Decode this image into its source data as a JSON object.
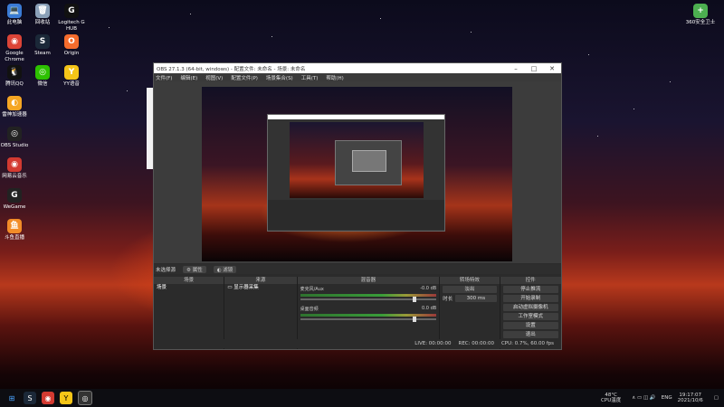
{
  "desktop": {
    "icons_left": [
      {
        "label": "此电脑",
        "color": "#3a7bd5",
        "glyph": "💻"
      },
      {
        "label": "Google Chrome",
        "color": "#db4437",
        "glyph": "◉"
      },
      {
        "label": "腾讯QQ",
        "color": "#111111",
        "glyph": "🐧"
      },
      {
        "label": "雷神加速器",
        "color": "#f5a623",
        "glyph": "◐"
      },
      {
        "label": "OBS Studio",
        "color": "#222222",
        "glyph": "◎"
      },
      {
        "label": "网易云音乐",
        "color": "#d33a31",
        "glyph": "◉"
      },
      {
        "label": "WeGame",
        "color": "#222222",
        "glyph": "G"
      },
      {
        "label": "斗鱼直播",
        "color": "#f28c28",
        "glyph": "鱼"
      }
    ],
    "icons_col2": [
      {
        "label": "回收站",
        "color": "#8aa0b8",
        "glyph": "🗑"
      },
      {
        "label": "Steam",
        "color": "#1b2838",
        "glyph": "S"
      },
      {
        "label": "微信",
        "color": "#2dc100",
        "glyph": "◎"
      }
    ],
    "icons_col3": [
      {
        "label": "Logitech G HUB",
        "color": "#111111",
        "glyph": "G"
      },
      {
        "label": "Origin",
        "color": "#f56c2d",
        "glyph": "O"
      },
      {
        "label": "YY语音",
        "color": "#f5c518",
        "glyph": "Y"
      }
    ],
    "icon_right": {
      "label": "360安全卫士",
      "color": "#4caf50",
      "glyph": "+"
    }
  },
  "obs": {
    "title": "OBS 27.1.3 (64-bit, windows) - 配置文件: 未命名 - 场景: 未命名",
    "menu": [
      "文件(F)",
      "编辑(E)",
      "视图(V)",
      "配置文件(P)",
      "场景集合(S)",
      "工具(T)",
      "帮助(H)"
    ],
    "source_bar": {
      "label": "未选择源",
      "properties": "属性",
      "filters": "滤镜"
    },
    "docks": {
      "scenes": {
        "header": "场景",
        "items": [
          "场景"
        ]
      },
      "sources": {
        "header": "来源",
        "items": [
          "显示器采集"
        ]
      },
      "mixer": {
        "header": "混音器",
        "channels": [
          {
            "name": "麦克风/Aux",
            "db": "-0.0 dB"
          },
          {
            "name": "桌面音频",
            "db": "0.0 dB"
          }
        ]
      },
      "transitions": {
        "header": "转场特效",
        "type": "淡出",
        "duration_label": "时长",
        "duration": "300 ms"
      },
      "controls": {
        "header": "控件",
        "buttons": [
          "停止推流",
          "开始录制",
          "启动虚拟摄像机",
          "工作室模式",
          "设置",
          "退出"
        ]
      }
    },
    "status": {
      "live": "LIVE: 00:00:00",
      "rec": "REC: 00:00:00",
      "cpu": "CPU: 0.7%, 60.00 fps"
    }
  },
  "taskbar": {
    "temp": "48°C",
    "temp_label": "CPU温度",
    "lang": "ENG",
    "time": "19:17:07",
    "date": "2021/10/6"
  }
}
